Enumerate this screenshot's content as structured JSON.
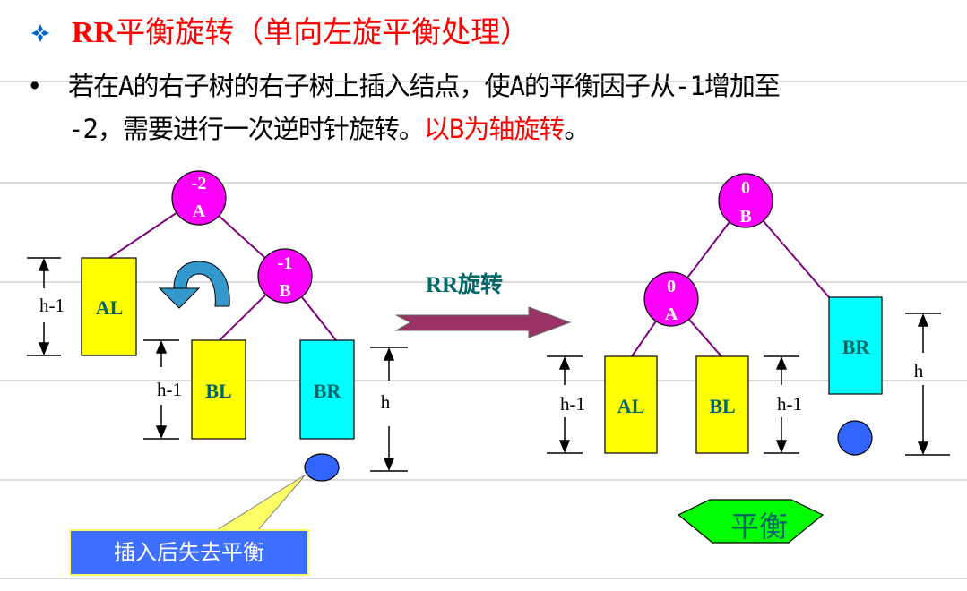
{
  "heading": {
    "title_rr": "RR",
    "title_rest": "平衡旋转（单向左旋平衡处理）"
  },
  "paragraph": {
    "bullet": "•",
    "line1": "若在A的右子树的右子树上插入结点，使A的平衡因子从-1增加至",
    "line2_black": "-2，需要进行一次逆时针旋转。",
    "line2_red": "以B为轴旋转",
    "line2_end": "。"
  },
  "before": {
    "nodeA": {
      "factor": "-2",
      "name": "A"
    },
    "nodeB": {
      "factor": "-1",
      "name": "B"
    },
    "AL": "AL",
    "BL": "BL",
    "BR": "BR",
    "dim_AL": "h-1",
    "dim_BL": "h-1",
    "dim_BR": "h"
  },
  "arrow_label": "RR旋转",
  "after": {
    "nodeB": {
      "factor": "0",
      "name": "B"
    },
    "nodeA": {
      "factor": "0",
      "name": "A"
    },
    "AL": "AL",
    "BL": "BL",
    "BR": "BR",
    "dim_AL": "h-1",
    "dim_BL": "h-1",
    "dim_BR": "h"
  },
  "callout": "插入后失去平衡",
  "balanced_badge": "平衡",
  "colors": {
    "node": "#ff00ff",
    "yellow_box": "#ffff00",
    "cyan_box": "#00ffff",
    "inserted_node": "#3366ff",
    "callout_bg": "#3f6fff",
    "badge": "#00ff00",
    "arrow": "#993366",
    "rotate_arrow": "#3399cc",
    "edge": "#800080",
    "label_blue": "#006666"
  },
  "icons": {
    "heading_bullet": "diamond-four-petal-icon",
    "rotate": "counterclockwise-arrow-icon"
  }
}
